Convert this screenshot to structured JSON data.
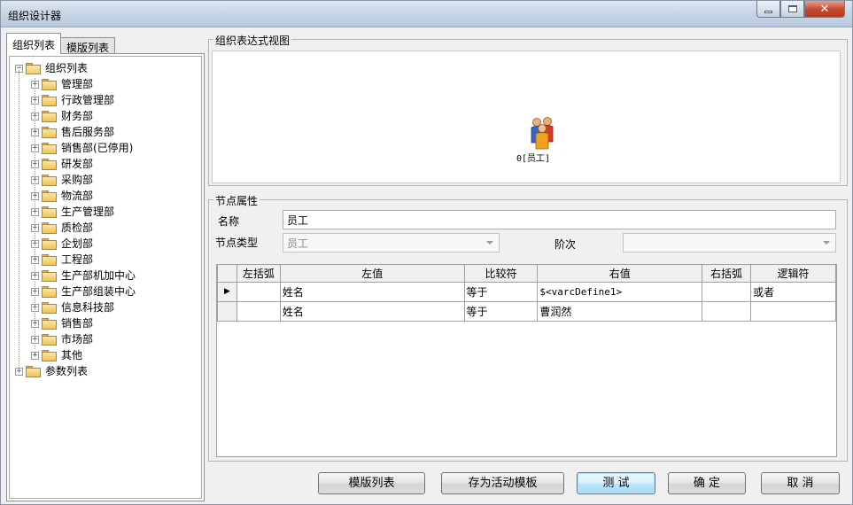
{
  "window": {
    "title": "组织设计器"
  },
  "left_tabs": [
    {
      "label": "组织列表",
      "active": true
    },
    {
      "label": "模版列表",
      "active": false
    }
  ],
  "tree": {
    "root_label": "组织列表",
    "children": [
      "管理部",
      "行政管理部",
      "财务部",
      "售后服务部",
      "销售部(已停用)",
      "研发部",
      "采购部",
      "物流部",
      "生产管理部",
      "质检部",
      "企划部",
      "工程部",
      "生产部机加中心",
      "生产部组装中心",
      "信息科技部",
      "销售部",
      "市场部",
      "其他"
    ],
    "second_root_label": "参数列表"
  },
  "diagram": {
    "group_label": "组织表达式视图",
    "node_label": "0[员工]",
    "node_icon": "people-icon"
  },
  "properties": {
    "group_label": "节点属性",
    "name_label": "名称",
    "name_value": "员工",
    "type_label": "节点类型",
    "type_value": "员工",
    "level_label": "阶次",
    "level_value": ""
  },
  "grid": {
    "columns": [
      "左括弧",
      "左值",
      "比较符",
      "右值",
      "右括弧",
      "逻辑符"
    ],
    "rows": [
      {
        "left_paren": "",
        "left_value": "姓名",
        "op": "等于",
        "right_value": "$<varcDefine1>",
        "right_paren": "",
        "logic": "或者",
        "current": true
      },
      {
        "left_paren": "",
        "left_value": "姓名",
        "op": "等于",
        "right_value": "曹润然",
        "right_paren": "",
        "logic": "",
        "current": false
      }
    ]
  },
  "buttons": {
    "template_list": "模版列表",
    "save_active": "存为活动模板",
    "test": "测 试",
    "ok": "确 定",
    "cancel": "取 消"
  },
  "colors": {
    "folder": "#f2c355",
    "default_button_border": "#3c7fb1",
    "close_button": "#c7472e"
  }
}
